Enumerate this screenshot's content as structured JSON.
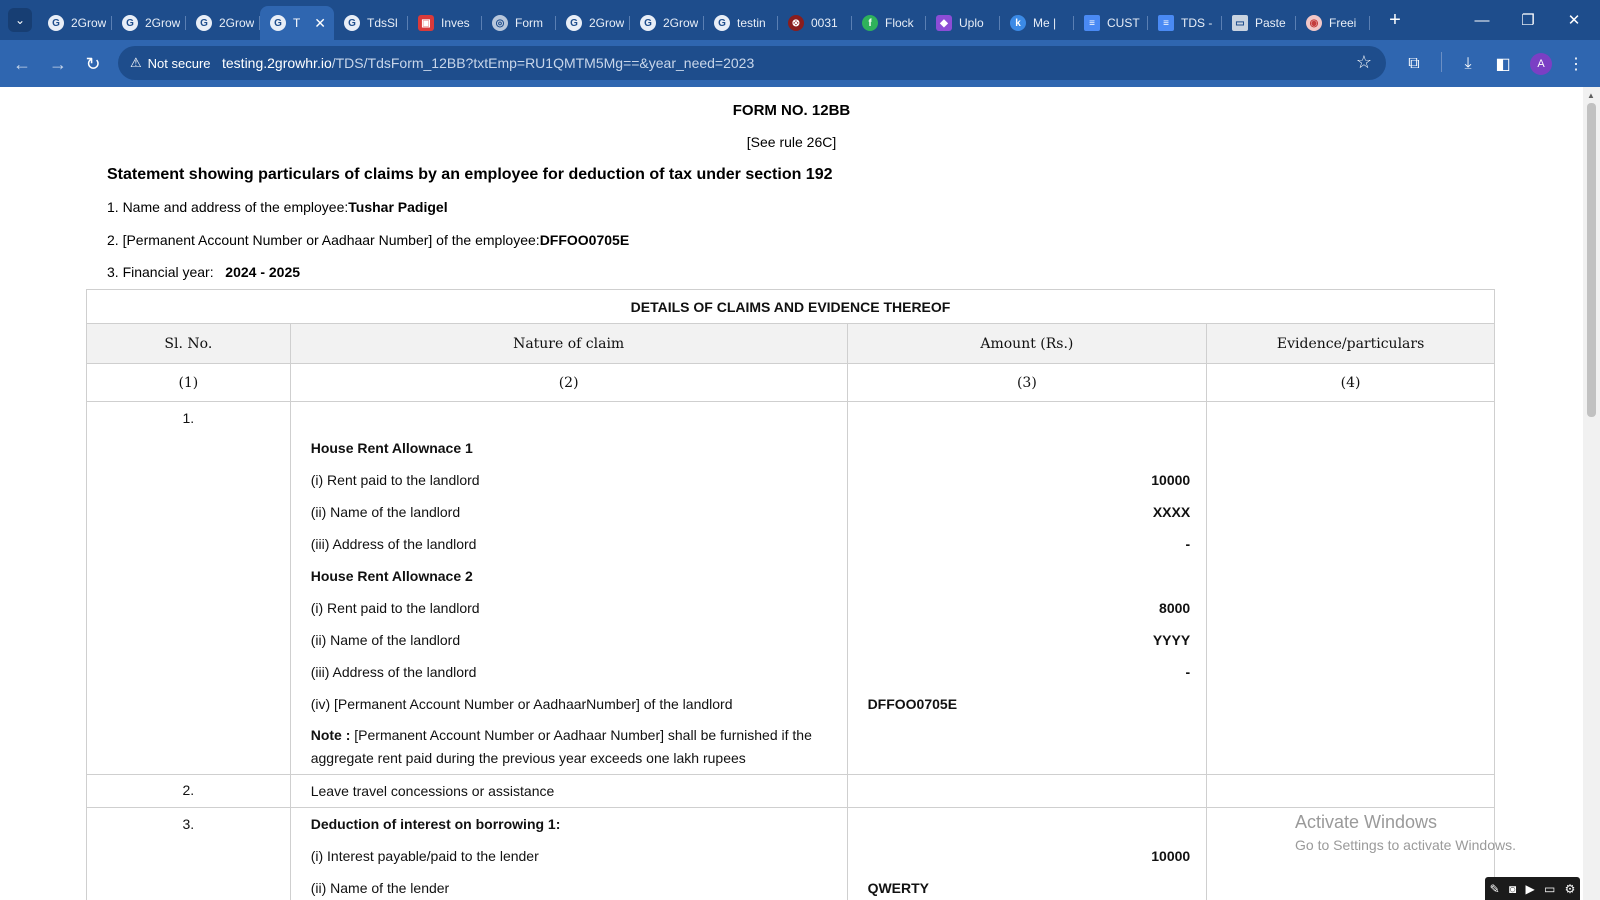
{
  "browser": {
    "tabs": [
      {
        "label": "2Grow",
        "icon": "twogrow-favicon-icon",
        "icon_glyph": "G",
        "icon_class": "c2g"
      },
      {
        "label": "2Grow",
        "icon": "twogrow-favicon-icon",
        "icon_glyph": "G",
        "icon_class": "c2g"
      },
      {
        "label": "2Grow",
        "icon": "twogrow-favicon-icon",
        "icon_glyph": "G",
        "icon_class": "c2g"
      },
      {
        "label": "T",
        "icon": "twogrow-favicon-icon",
        "icon_glyph": "G",
        "icon_class": "c2g",
        "active": true
      },
      {
        "label": "TdsSl",
        "icon": "twogrow-favicon-icon",
        "icon_glyph": "G",
        "icon_class": "c2g"
      },
      {
        "label": "Inves",
        "icon": "invest-favicon-icon",
        "icon_glyph": "▣",
        "icon_class": "cred"
      },
      {
        "label": "Form",
        "icon": "globe-icon",
        "icon_glyph": "◎",
        "icon_class": "cglobe"
      },
      {
        "label": "2Grow",
        "icon": "twogrow-favicon-icon",
        "icon_glyph": "G",
        "icon_class": "c2g"
      },
      {
        "label": "2Grow",
        "icon": "twogrow-favicon-icon",
        "icon_glyph": "G",
        "icon_class": "c2g"
      },
      {
        "label": "testin",
        "icon": "twogrow-favicon-icon",
        "icon_glyph": "G",
        "icon_class": "c2g"
      },
      {
        "label": "0031",
        "icon": "dark-red-favicon-icon",
        "icon_glyph": "⊗",
        "icon_class": "cdark"
      },
      {
        "label": "Flock",
        "icon": "flock-favicon-icon",
        "icon_glyph": "f",
        "icon_class": "cgreen"
      },
      {
        "label": "Uplo",
        "icon": "upload-favicon-icon",
        "icon_glyph": "◆",
        "icon_class": "cpurple"
      },
      {
        "label": "Me |",
        "icon": "k-favicon-icon",
        "icon_glyph": "k",
        "icon_class": "cblue"
      },
      {
        "label": "CUST",
        "icon": "docs-favicon-icon",
        "icon_glyph": "≡",
        "icon_class": "cdoc"
      },
      {
        "label": "TDS -",
        "icon": "docs-favicon-icon",
        "icon_glyph": "≡",
        "icon_class": "cdoc"
      },
      {
        "label": "Paste",
        "icon": "paste-favicon-icon",
        "icon_glyph": "▭",
        "icon_class": "cpaste"
      },
      {
        "label": "Freei",
        "icon": "freei-favicon-icon",
        "icon_glyph": "◉",
        "icon_class": "cpink"
      }
    ],
    "security_label": "Not secure",
    "url_host": "testing.2growhr.io",
    "url_rest": "/TDS/TdsForm_12BB?txtEmp=RU1QMTM5Mg==&year_need=2023",
    "profile_initial": "A",
    "colors": {
      "tabbar": "#1e4d8c",
      "toolbar": "#2f66b0"
    }
  },
  "form": {
    "title": "FORM NO. 12BB",
    "rule": "[See rule 26C]",
    "statement": "Statement showing particulars of claims by an employee for deduction of tax under section 192",
    "employee_name_label": "1. Name and address of the employee:",
    "employee_name": "Tushar Padigel",
    "pan_label": "2. [Permanent Account Number or Aadhaar Number] of the employee:",
    "pan": "DFFOO0705E",
    "fy_label": "3. Financial year:",
    "fy": "2024 - 2025"
  },
  "table": {
    "heading": "DETAILS OF CLAIMS AND EVIDENCE THEREOF",
    "columns": [
      "Sl. No.",
      "Nature of claim",
      "Amount (Rs.)",
      "Evidence/particulars"
    ],
    "column_numbers": [
      "(1)",
      "(2)",
      "(3)",
      "(4)"
    ],
    "row1": {
      "sl": "1.",
      "hra1_heading": "House Rent Allownace 1",
      "hra1_rent_label": "(i) Rent paid to the landlord",
      "hra1_rent": "10000",
      "hra1_name_label": "(ii) Name of the landlord",
      "hra1_name": "XXXX",
      "hra1_addr_label": "(iii) Address of the landlord",
      "hra1_addr": "-",
      "hra2_heading": "House Rent Allownace 2",
      "hra2_rent_label": "(i) Rent paid to the landlord",
      "hra2_rent": "8000",
      "hra2_name_label": "(ii) Name of the landlord",
      "hra2_name": "YYYY",
      "hra2_addr_label": "(iii) Address of the landlord",
      "hra2_addr": "-",
      "pan_label": "(iv) [Permanent Account Number or AadhaarNumber] of the landlord",
      "pan": "DFFOO0705E",
      "note_bold": "Note :",
      "note_text": " [Permanent Account Number or Aadhaar Number] shall be furnished if the aggregate rent paid during the previous year exceeds one lakh rupees"
    },
    "row2": {
      "sl": "2.",
      "claim": "Leave travel concessions or assistance"
    },
    "row3": {
      "sl": "3.",
      "heading": "Deduction of interest on borrowing 1:",
      "interest_label": "(i) Interest payable/paid to the lender",
      "interest": "10000",
      "lender_name_label": "(ii) Name of the lender",
      "lender_name": "QWERTY"
    }
  },
  "watermark": {
    "line1": "Activate Windows",
    "line2": "Go to Settings to activate Windows."
  }
}
